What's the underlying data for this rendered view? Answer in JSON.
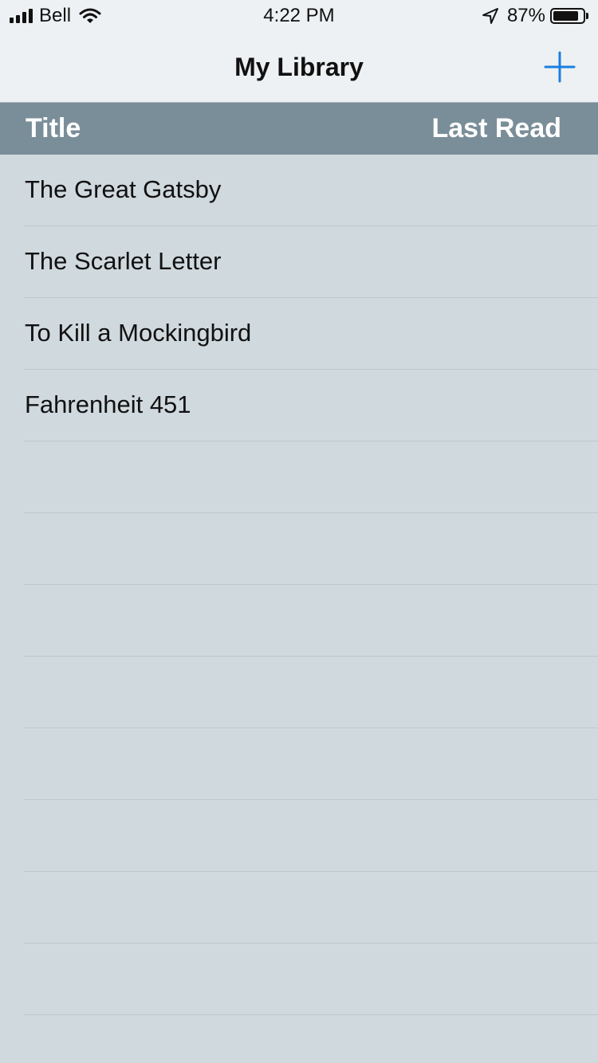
{
  "status_bar": {
    "carrier": "Bell",
    "time": "4:22 PM",
    "battery_text": "87%",
    "battery_level": 0.87,
    "signal_icon": "signal-bars-icon",
    "wifi_icon": "wifi-icon",
    "location_icon": "location-arrow-icon",
    "battery_icon": "battery-icon"
  },
  "nav": {
    "title": "My Library",
    "add_icon": "plus-icon",
    "accent_color": "#1a7fe0"
  },
  "table": {
    "columns": [
      "Title",
      "Last Read"
    ],
    "header_color": "#7a8e99",
    "rows": [
      {
        "title": "The Great Gatsby",
        "last_read": ""
      },
      {
        "title": "The Scarlet Letter",
        "last_read": ""
      },
      {
        "title": "To Kill a Mockingbird",
        "last_read": ""
      },
      {
        "title": "Fahrenheit 451",
        "last_read": ""
      }
    ]
  }
}
